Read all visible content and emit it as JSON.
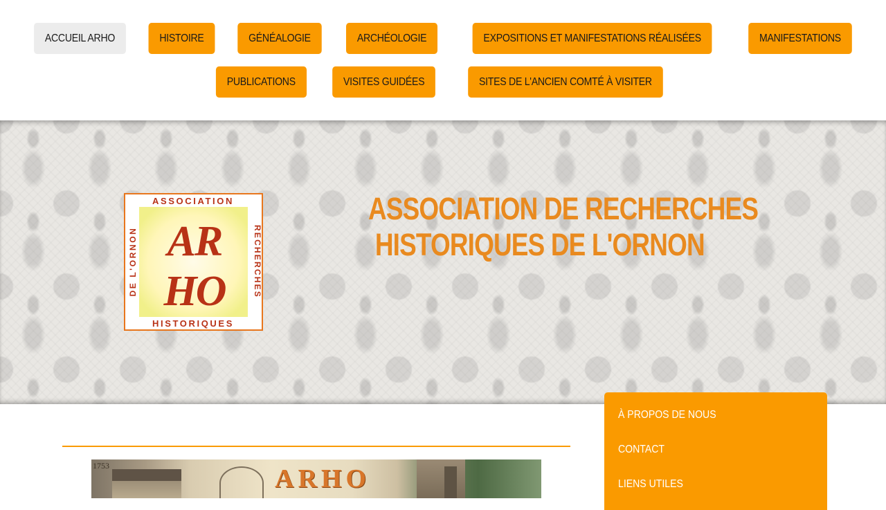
{
  "nav": {
    "row1": [
      {
        "label": "ACCUEIL ARHO",
        "active": true
      },
      {
        "label": "HISTOIRE",
        "active": false
      },
      {
        "label": "GÉNÉALOGIE",
        "active": false
      },
      {
        "label": "ARCHÉOLOGIE",
        "active": false
      },
      {
        "label": "EXPOSITIONS ET MANIFESTATIONS RÉALISÉES",
        "active": false
      },
      {
        "label": "MANIFESTATIONS",
        "active": false
      }
    ],
    "row2": [
      {
        "label": "PUBLICATIONS",
        "active": false
      },
      {
        "label": "VISITES GUIDÉES",
        "active": false
      },
      {
        "label": "SITES DE L'ANCIEN COMTÉ À VISITER",
        "active": false
      }
    ]
  },
  "header": {
    "title_line1": "ASSOCIATION DE RECHERCHES",
    "title_line2": "HISTORIQUES DE L'ORNON",
    "logo": {
      "top_text": "ASSOCIATION",
      "right_text": "RECHERCHES",
      "bottom_text": "HISTORIQUES",
      "left_text": "DE L'ORNON",
      "monogram_1": "AR",
      "monogram_2": "HO"
    }
  },
  "main": {
    "hero": {
      "text": "ARHO",
      "date": "1753"
    }
  },
  "sidebar": {
    "items": [
      {
        "label": "À PROPOS DE NOUS"
      },
      {
        "label": "CONTACT"
      },
      {
        "label": "LIENS UTILES"
      }
    ]
  },
  "colors": {
    "accent": "#fa9a00",
    "title": "#e98a1f",
    "logo_red": "#b83216",
    "active_nav": "#ececec"
  }
}
